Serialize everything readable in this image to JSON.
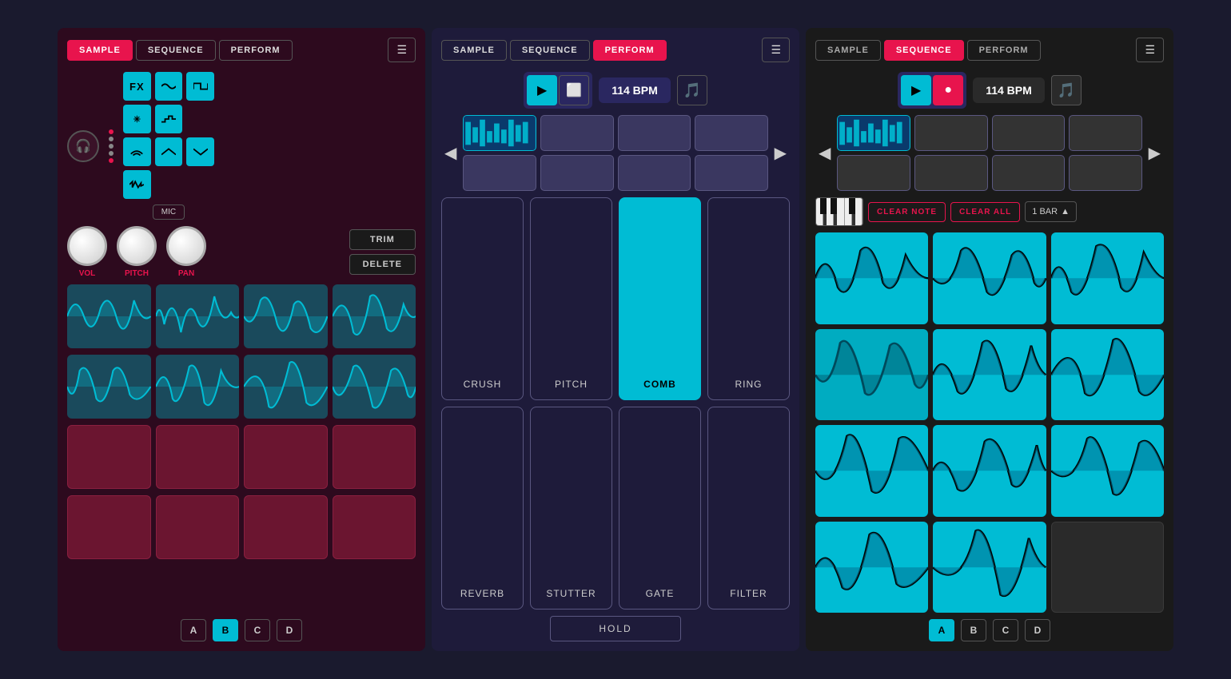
{
  "panels": [
    {
      "id": "left",
      "tabs": [
        "SAMPLE",
        "SEQUENCE",
        "PERFORM"
      ],
      "activeTab": "SAMPLE",
      "controls": {
        "knobs": [
          "VOL",
          "PITCH",
          "PAN"
        ],
        "buttons": [
          "TRIM",
          "DELETE"
        ],
        "mic": "MIC",
        "fx": "FX"
      },
      "pageTabs": [
        "A",
        "B",
        "C",
        "D"
      ],
      "activePageTab": "B"
    },
    {
      "id": "mid",
      "tabs": [
        "SAMPLE",
        "SEQUENCE",
        "PERFORM"
      ],
      "activeTab": "PERFORM",
      "bpm": "114 BPM",
      "fxButtons": [
        {
          "label": "CRUSH",
          "active": false
        },
        {
          "label": "PITCH",
          "active": false
        },
        {
          "label": "COMB",
          "active": true
        },
        {
          "label": "RING",
          "active": false
        },
        {
          "label": "REVERB",
          "active": false
        },
        {
          "label": "STUTTER",
          "active": false
        },
        {
          "label": "GATE",
          "active": false
        },
        {
          "label": "FILTER",
          "active": false
        }
      ],
      "hold": "HOLD"
    },
    {
      "id": "right",
      "tabs": [
        "SAMPLE",
        "SEQUENCE",
        "PERFORM"
      ],
      "activeTab": "SEQUENCE",
      "bpm": "114 BPM",
      "controls": {
        "clearNote": "CLEAR NOTE",
        "clearAll": "CLEAR ALL",
        "bar": "1 BAR"
      },
      "pageTabs": [
        "A",
        "B",
        "C",
        "D"
      ],
      "activePageTab": "A"
    }
  ]
}
